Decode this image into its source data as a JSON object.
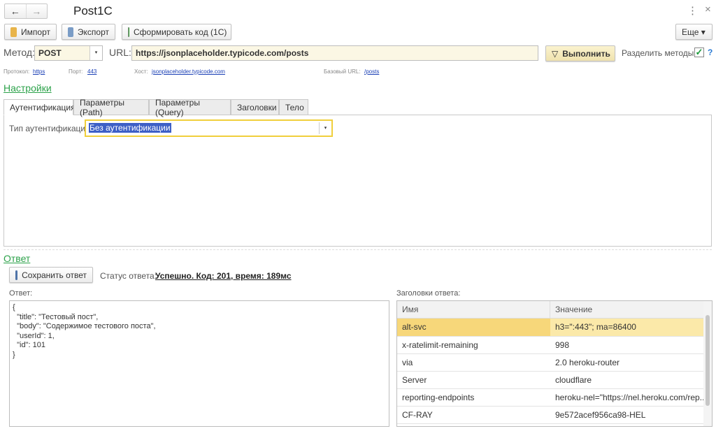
{
  "window": {
    "title": "Post1C",
    "back": "←",
    "forward": "→",
    "more_icon": "⋮",
    "close_icon": "×"
  },
  "toolbar": {
    "import": "Импорт",
    "export": "Экспорт",
    "generate": "Сформировать код (1С)",
    "more": "Еще ▾"
  },
  "request": {
    "method_label": "Метод:",
    "method": "POST",
    "url_label": "URL:",
    "url": "https://jsonplaceholder.typicode.com/posts",
    "execute": "Выполнить",
    "split_label": "Разделить методы:",
    "split_checked": true,
    "help": "?"
  },
  "url_parts": {
    "protocol_label": "Протокол:",
    "protocol": "https",
    "port_label": "Порт:",
    "port": "443",
    "host_label": "Хост:",
    "host": "jsonplaceholder.typicode.com",
    "base_label": "Базовый URL:",
    "base": "/posts"
  },
  "settings": {
    "title": "Настройки",
    "tabs": [
      "Аутентификация",
      "Параметры (Path)",
      "Параметры (Query)",
      "Заголовки",
      "Тело"
    ],
    "auth_label": "Тип аутентификации:",
    "auth_value": "Без аутентификации"
  },
  "response": {
    "title": "Ответ",
    "save": "Сохранить ответ",
    "status_label": "Статус ответа:",
    "status": "Успешно. Код: 201, время: 189мс",
    "body_label": "Ответ:",
    "body": "{\n  \"title\": \"Тестовый пост\",\n  \"body\": \"Содержимое тестового поста\",\n  \"userId\": 1,\n  \"id\": 101\n}",
    "headers_label": "Заголовки ответа:",
    "columns": [
      "Имя",
      "Значение"
    ],
    "headers": [
      [
        "alt-svc",
        "h3=\":443\"; ma=86400"
      ],
      [
        "x-ratelimit-remaining",
        "998"
      ],
      [
        "via",
        "2.0 heroku-router"
      ],
      [
        "Server",
        "cloudflare"
      ],
      [
        "reporting-endpoints",
        "heroku-nel=\"https://nel.heroku.com/rep..."
      ],
      [
        "CF-RAY",
        "9e572acef956ca98-HEL"
      ]
    ]
  }
}
